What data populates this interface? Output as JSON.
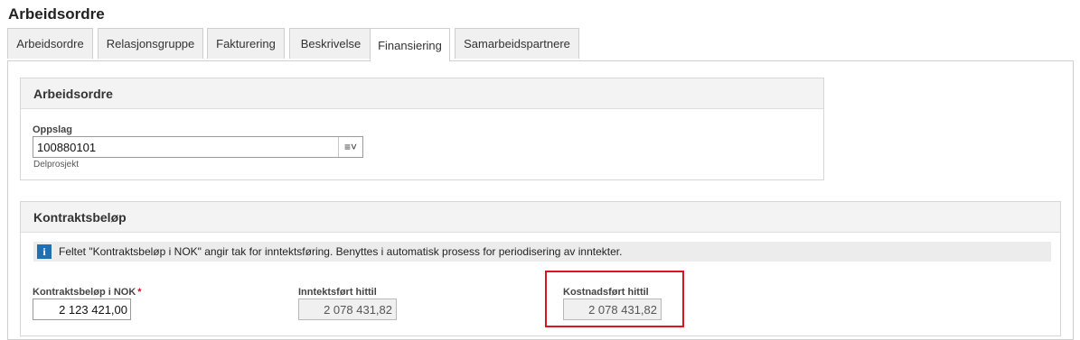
{
  "page": {
    "title": "Arbeidsordre"
  },
  "tabs": [
    {
      "label": "Arbeidsordre"
    },
    {
      "label": "Relasjonsgruppe"
    },
    {
      "label": "Fakturering"
    },
    {
      "label": "Beskrivelse"
    },
    {
      "label": "Finansiering"
    },
    {
      "label": "Samarbeidspartnere"
    }
  ],
  "active_tab": "Finansiering",
  "arbeidsordre_panel": {
    "title": "Arbeidsordre",
    "lookup_label": "Oppslag",
    "lookup_value": "100880101",
    "lookup_sub": "Delprosjekt",
    "lookup_icon": "list-dropdown-icon"
  },
  "kontrakt_panel": {
    "title": "Kontraktsbeløp",
    "info_text": "Feltet \"Kontraktsbeløp i NOK\" angir tak for inntektsføring. Benyttes i automatisk prosess for periodisering av inntekter.",
    "info_icon": "info-icon",
    "fields": {
      "kontrakt": {
        "label": "Kontraktsbeløp i NOK",
        "required_mark": "*",
        "value": "2 123 421,00"
      },
      "inntekt": {
        "label": "Inntektsført hittil",
        "value": "2 078 431,82"
      },
      "kostnad": {
        "label": "Kostnadsført hittil",
        "value": "2 078 431,82"
      }
    }
  },
  "colors": {
    "highlight": "#d9161b",
    "required": "#c8102e",
    "info_icon": "#1f6fb2"
  }
}
